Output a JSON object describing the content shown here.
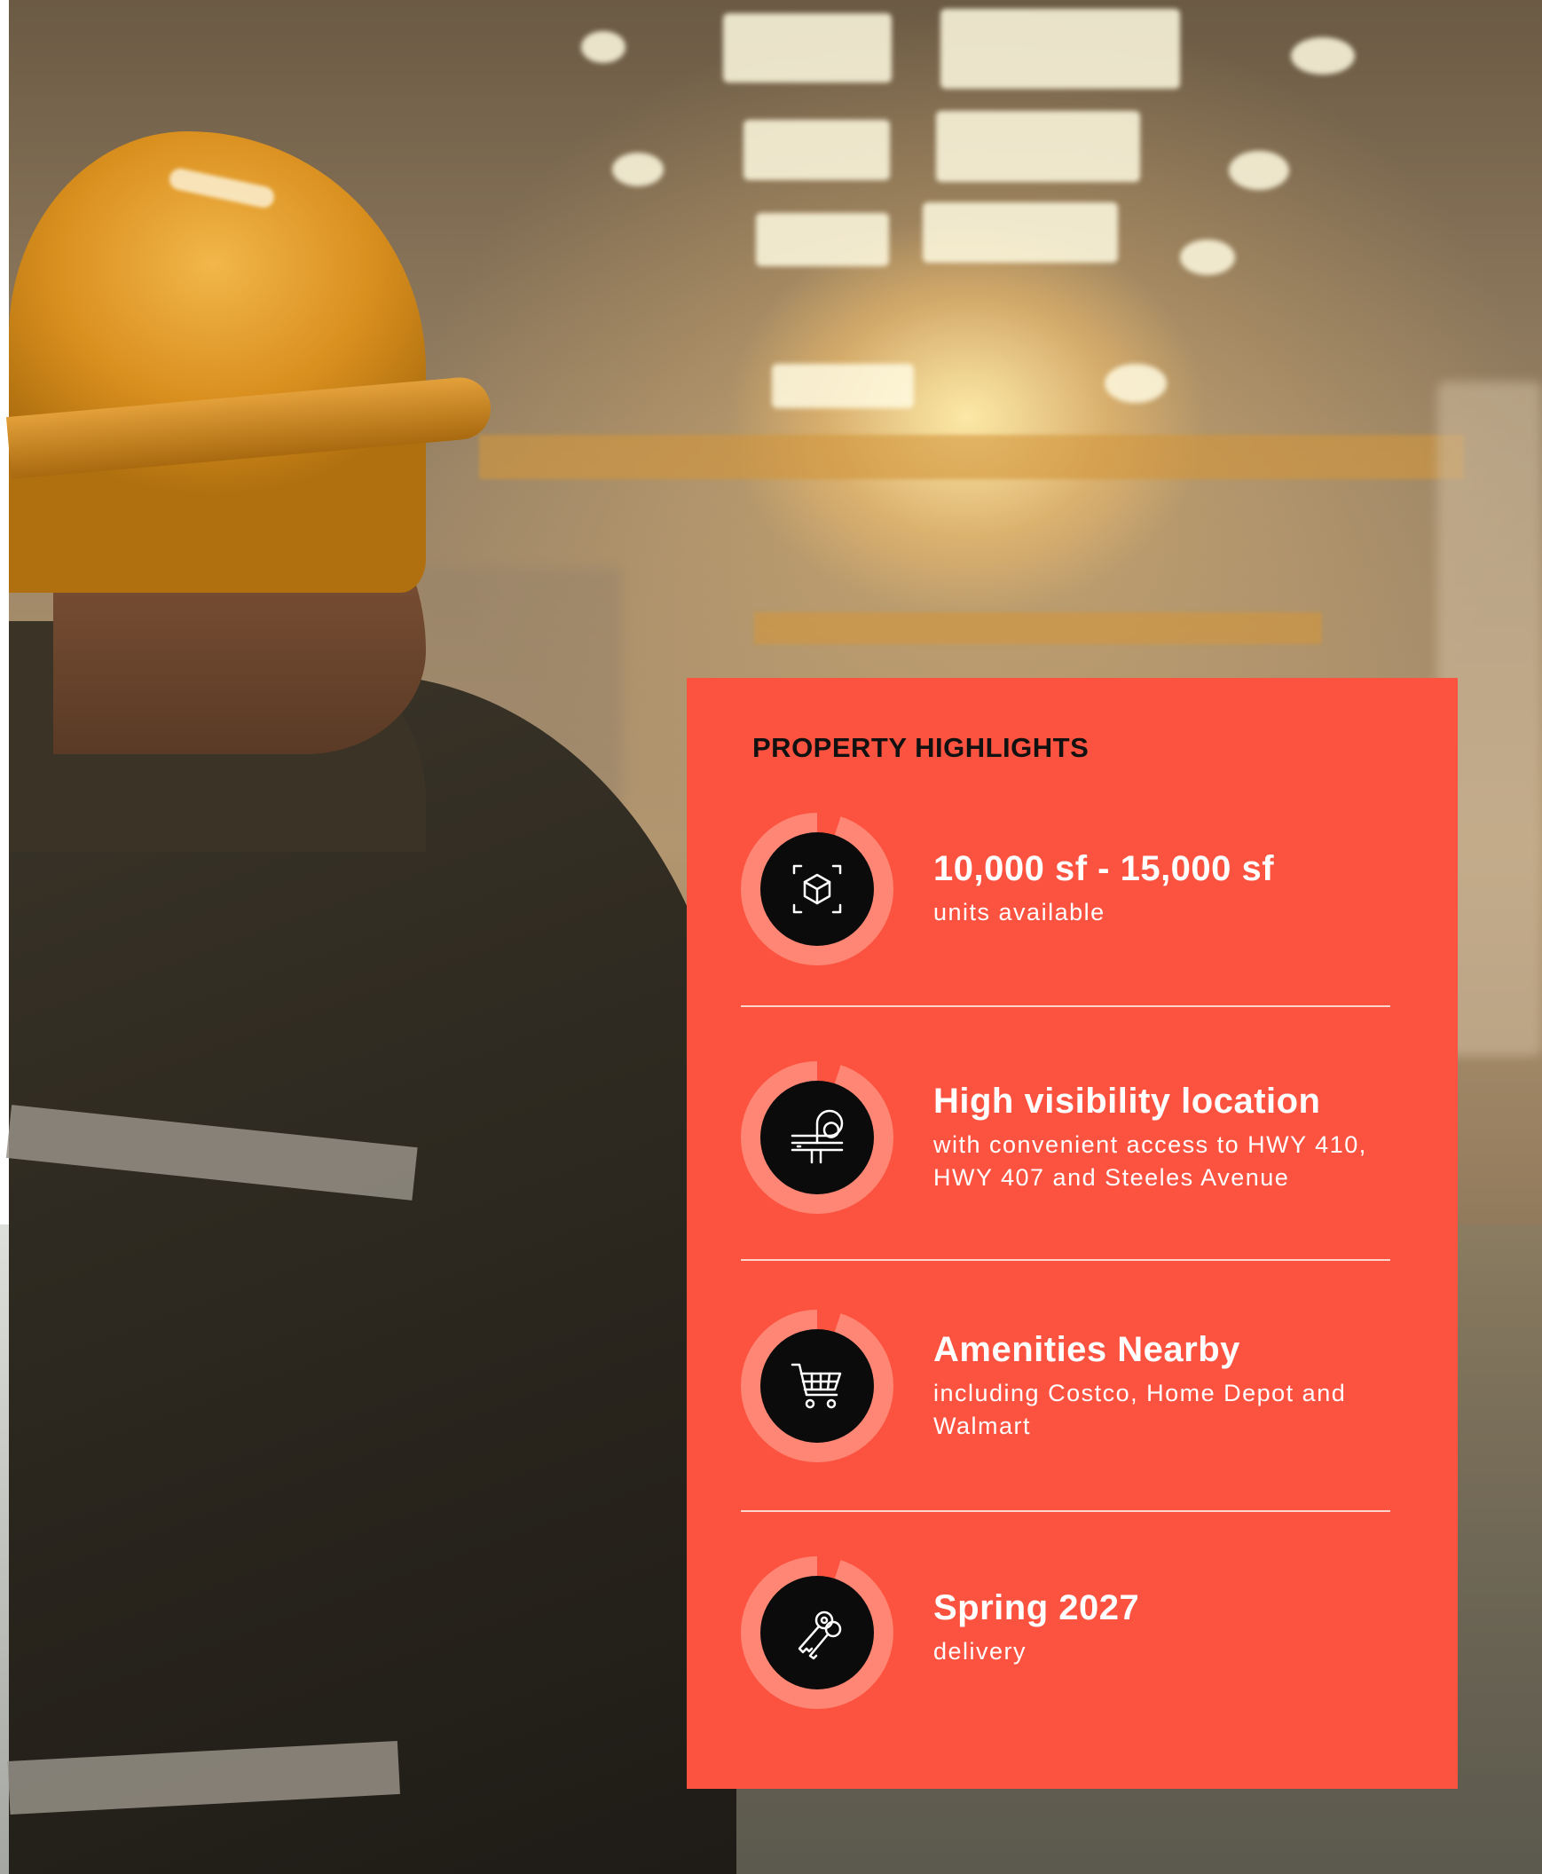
{
  "background": {
    "photo": "warehouse-worker-photo"
  },
  "highlights": {
    "title": "PROPERTY HIGHLIGHTS",
    "accent_color": "#fc5340",
    "icon_bg": "#0b0b0b",
    "items": [
      {
        "icon": "box-icon",
        "heading": "10,000 sf - 15,000 sf",
        "detail": "units available"
      },
      {
        "icon": "highway-interchange-icon",
        "heading": "High visibility location",
        "detail": "with convenient access to HWY 410, HWY 407 and Steeles Avenue"
      },
      {
        "icon": "shopping-cart-icon",
        "heading": "Amenities Nearby",
        "detail": "including Costco, Home Depot and Walmart"
      },
      {
        "icon": "keys-icon",
        "heading": "Spring 2027",
        "detail": "delivery"
      }
    ]
  }
}
